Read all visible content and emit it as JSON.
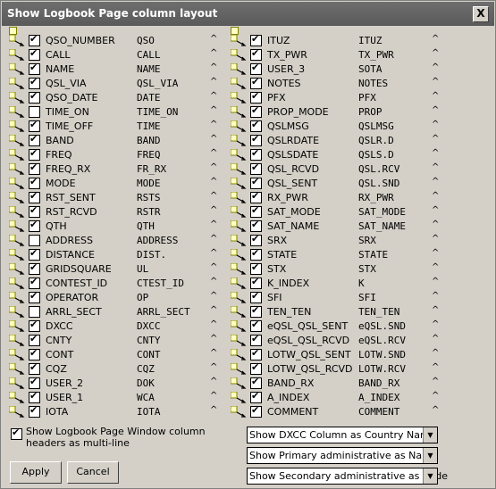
{
  "window": {
    "title": "Show Logbook Page column layout",
    "close_label": "X"
  },
  "left_rows": [
    {
      "field": "QSO_NUMBER",
      "header": "QSO",
      "checked": true
    },
    {
      "field": "CALL",
      "header": "CALL",
      "checked": true
    },
    {
      "field": "NAME",
      "header": "NAME",
      "checked": true
    },
    {
      "field": "QSL_VIA",
      "header": "QSL_VIA",
      "checked": true
    },
    {
      "field": "QSO_DATE",
      "header": "DATE",
      "checked": true
    },
    {
      "field": "TIME_ON",
      "header": "TIME_ON",
      "checked": false
    },
    {
      "field": "TIME_OFF",
      "header": "TIME",
      "checked": true
    },
    {
      "field": "BAND",
      "header": "BAND",
      "checked": true
    },
    {
      "field": "FREQ",
      "header": "FREQ",
      "checked": true
    },
    {
      "field": "FREQ_RX",
      "header": "FR_RX",
      "checked": true
    },
    {
      "field": "MODE",
      "header": "MODE",
      "checked": true
    },
    {
      "field": "RST_SENT",
      "header": "RSTS",
      "checked": true
    },
    {
      "field": "RST_RCVD",
      "header": "RSTR",
      "checked": true
    },
    {
      "field": "QTH",
      "header": "QTH",
      "checked": true
    },
    {
      "field": "ADDRESS",
      "header": "ADDRESS",
      "checked": false
    },
    {
      "field": "DISTANCE",
      "header": "DIST.",
      "checked": true
    },
    {
      "field": "GRIDSQUARE",
      "header": "UL",
      "checked": true
    },
    {
      "field": "CONTEST_ID",
      "header": "CTEST_ID",
      "checked": true
    },
    {
      "field": "OPERATOR",
      "header": "OP",
      "checked": true
    },
    {
      "field": "ARRL_SECT",
      "header": "ARRL_SECT",
      "checked": false
    },
    {
      "field": "DXCC",
      "header": "DXCC",
      "checked": true
    },
    {
      "field": "CNTY",
      "header": "CNTY",
      "checked": true
    },
    {
      "field": "CONT",
      "header": "CONT",
      "checked": true
    },
    {
      "field": "CQZ",
      "header": "CQZ",
      "checked": true
    },
    {
      "field": "USER_2",
      "header": "DOK",
      "checked": true
    },
    {
      "field": "USER_1",
      "header": "WCA",
      "checked": true
    },
    {
      "field": "IOTA",
      "header": "IOTA",
      "checked": true
    }
  ],
  "right_rows": [
    {
      "field": "ITUZ",
      "header": "ITUZ",
      "checked": true
    },
    {
      "field": "TX_PWR",
      "header": "TX_PWR",
      "checked": true
    },
    {
      "field": "USER_3",
      "header": "SOTA",
      "checked": true
    },
    {
      "field": "NOTES",
      "header": "NOTES",
      "checked": true
    },
    {
      "field": "PFX",
      "header": "PFX",
      "checked": true
    },
    {
      "field": "PROP_MODE",
      "header": "PROP",
      "checked": true
    },
    {
      "field": "QSLMSG",
      "header": "QSLMSG",
      "checked": true
    },
    {
      "field": "QSLRDATE",
      "header": "QSLR.D",
      "checked": true
    },
    {
      "field": "QSLSDATE",
      "header": "QSLS.D",
      "checked": true
    },
    {
      "field": "QSL_RCVD",
      "header": "QSL.RCV",
      "checked": true
    },
    {
      "field": "QSL_SENT",
      "header": "QSL.SND",
      "checked": true
    },
    {
      "field": "RX_PWR",
      "header": "RX_PWR",
      "checked": true
    },
    {
      "field": "SAT_MODE",
      "header": "SAT_MODE",
      "checked": true
    },
    {
      "field": "SAT_NAME",
      "header": "SAT_NAME",
      "checked": true
    },
    {
      "field": "SRX",
      "header": "SRX",
      "checked": true
    },
    {
      "field": "STATE",
      "header": "STATE",
      "checked": true
    },
    {
      "field": "STX",
      "header": "STX",
      "checked": true
    },
    {
      "field": "K_INDEX",
      "header": "K",
      "checked": true
    },
    {
      "field": "SFI",
      "header": "SFI",
      "checked": true
    },
    {
      "field": "TEN_TEN",
      "header": "TEN_TEN",
      "checked": true
    },
    {
      "field": "eQSL_QSL_SENT",
      "header": "eQSL.SND",
      "checked": true
    },
    {
      "field": "eQSL_QSL_RCVD",
      "header": "eQSL.RCV",
      "checked": true
    },
    {
      "field": "LOTW_QSL_SENT",
      "header": "LOTW.SND",
      "checked": true
    },
    {
      "field": "LOTW_QSL_RCVD",
      "header": "LOTW.RCV",
      "checked": true
    },
    {
      "field": "BAND_RX",
      "header": "BAND_RX",
      "checked": true
    },
    {
      "field": "A_INDEX",
      "header": "A_INDEX",
      "checked": true
    },
    {
      "field": "COMMENT",
      "header": "COMMENT",
      "checked": true
    }
  ],
  "caret": "^",
  "multiline": {
    "label": "Show Logbook Page Window column headers as multi-line",
    "checked": true
  },
  "selects": [
    {
      "value": "Show DXCC Column as Country Name"
    },
    {
      "value": "Show Primary administrative as Name"
    },
    {
      "value": "Show Secondary administrative as Code"
    }
  ],
  "buttons": {
    "apply": "Apply",
    "cancel": "Cancel"
  }
}
